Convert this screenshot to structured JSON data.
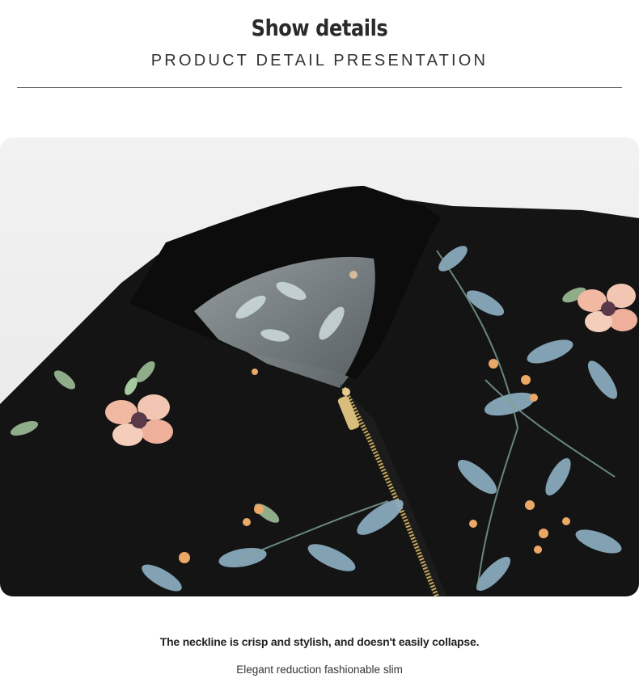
{
  "header": {
    "title": "Show details",
    "subtitle": "PRODUCT DETAIL PRESENTATION"
  },
  "photo": {
    "subject": "jacket-neckline-closeup-icon",
    "colors": {
      "background": "#eeeeee",
      "fabric": "#141414",
      "rib_collar": "#0c0c0c",
      "leaf": "#8fb3c7",
      "leaf_green": "#a7c9a0",
      "flower": "#f1b8a2",
      "berry": "#eba866",
      "zipper": "#c9a85c"
    }
  },
  "captions": {
    "line1": "The neckline is crisp and stylish, and doesn't easily collapse.",
    "line2": "Elegant  reduction fashionable slim"
  }
}
